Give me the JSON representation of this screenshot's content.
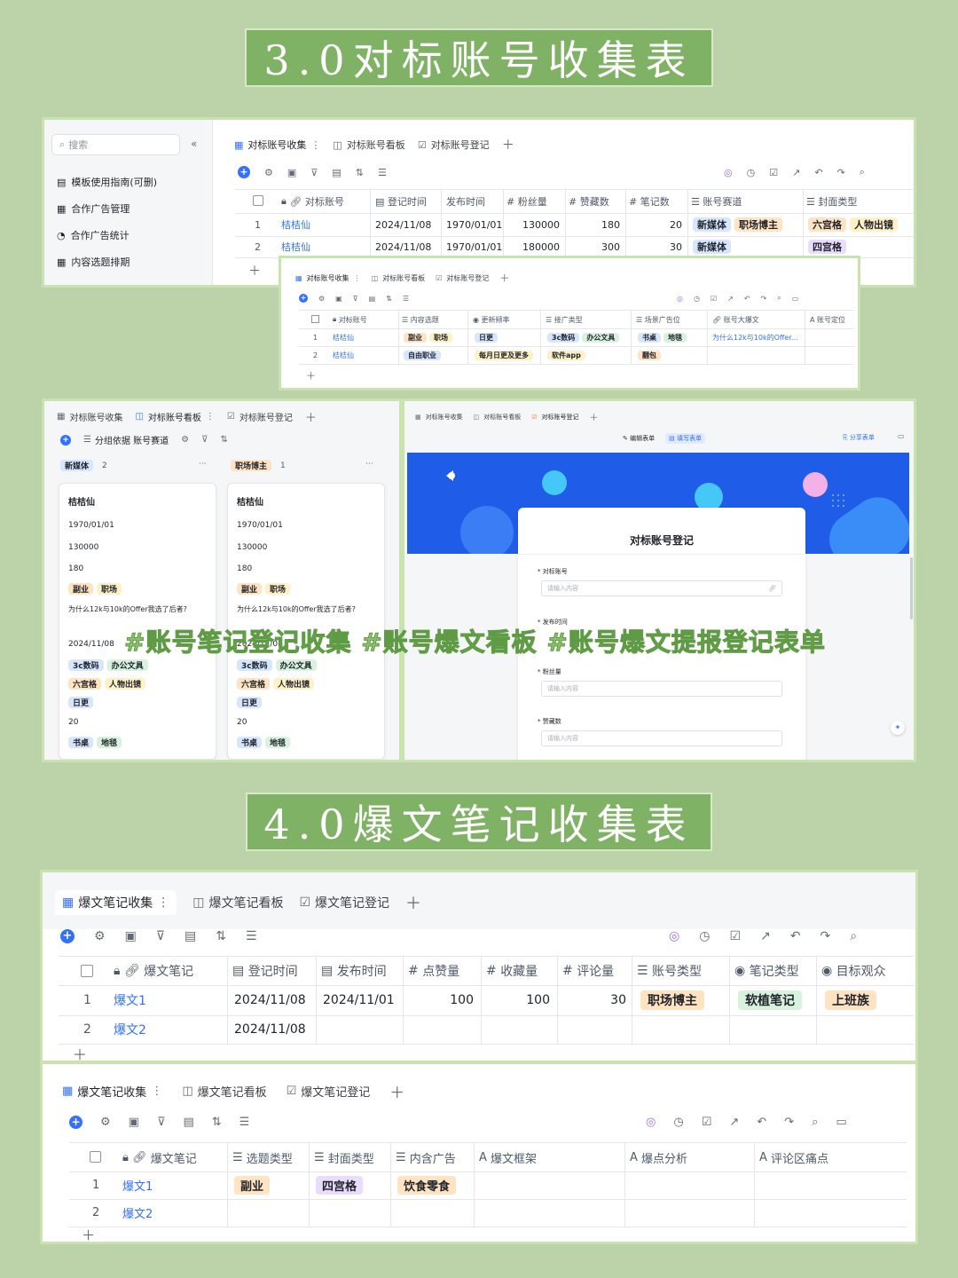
{
  "banners": {
    "top": "3.0对标账号收集表",
    "bottom": "4.0爆文笔记收集表"
  },
  "hashtags": "#账号笔记登记收集 #账号爆文看板 #账号爆文提报登记表单",
  "colors": {
    "background": "#bcd2a8",
    "banner": "#7fb265",
    "accent": "#3370ff"
  },
  "s1": {
    "search_placeholder": "搜索",
    "sidebar": [
      "模板使用指南(可删)",
      "合作广告管理",
      "合作广告统计",
      "内容选题排期"
    ],
    "tabs": [
      "对标账号收集",
      "对标账号看板",
      "对标账号登记"
    ],
    "headers": [
      "对标账号",
      "登记时间",
      "发布时间",
      "粉丝量",
      "赞藏数",
      "笔记数",
      "账号赛道",
      "封面类型"
    ],
    "rows": [
      {
        "no": "1",
        "name": "桔桔仙",
        "reg": "2024/11/08",
        "pub": "1970/01/01",
        "fans": "130000",
        "likes": "180",
        "notes": "20",
        "track": [
          "新媒体",
          "职场博主"
        ],
        "cover": [
          "六宫格",
          "人物出镜"
        ]
      },
      {
        "no": "2",
        "name": "桔桔仙",
        "reg": "2024/11/08",
        "pub": "1970/01/01",
        "fans": "180000",
        "likes": "300",
        "notes": "30",
        "track": [
          "新媒体"
        ],
        "cover": [
          "四宫格"
        ]
      }
    ]
  },
  "s2": {
    "tabs": [
      "对标账号收集",
      "对标账号看板",
      "对标账号登记"
    ],
    "headers": [
      "对标账号",
      "内容选题",
      "更新频率",
      "接广类型",
      "场景广告位",
      "账号大爆文",
      "账号定位"
    ],
    "rows": [
      {
        "no": "1",
        "name": "桔桔仙",
        "topic": [
          "副业",
          "职场"
        ],
        "freq": [
          "日更"
        ],
        "ad": [
          "3c数码",
          "办公文具"
        ],
        "scene": [
          "书桌",
          "地毯"
        ],
        "hit": "为什么12k与10k的Offer..."
      },
      {
        "no": "2",
        "name": "桔桔仙",
        "topic": [
          "自由职业"
        ],
        "freq": [
          "每月日更及更多"
        ],
        "ad": [
          "软件app"
        ],
        "scene": [
          "翻包"
        ],
        "hit": ""
      }
    ]
  },
  "s3": {
    "tabs": [
      "对标账号收集",
      "对标账号看板",
      "对标账号登记"
    ],
    "group_label": "分组依据 账号赛道",
    "columns": [
      {
        "name": "新媒体",
        "count": "2"
      },
      {
        "name": "职场博主",
        "count": "1"
      }
    ],
    "card": {
      "title": "桔桔仙",
      "pub": "1970/01/01",
      "fans": "130000",
      "likes": "180",
      "topic": [
        "副业",
        "职场"
      ],
      "hit": "为什么12k与10k的Offer我选了后者?",
      "reg": "2024/11/08",
      "ad": [
        "3c数码",
        "办公文具"
      ],
      "cover": [
        "六宫格",
        "人物出镜"
      ],
      "freq": [
        "日更"
      ],
      "notes": "20",
      "scene": [
        "书桌",
        "地毯"
      ]
    }
  },
  "s4": {
    "tabs": [
      "对标账号收集",
      "对标账号看板",
      "对标账号登记"
    ],
    "edit_form": "编辑表单",
    "fill_form": "填写表单",
    "share_form": "分享表单",
    "form_title": "对标账号登记",
    "fields": [
      {
        "label": "* 对标账号",
        "placeholder": "请输入内容"
      },
      {
        "label": "* 发布时间",
        "placeholder": ""
      },
      {
        "label": "* 粉丝量",
        "placeholder": "请输入内容"
      },
      {
        "label": "* 赞藏数",
        "placeholder": "请输入内容"
      }
    ]
  },
  "s5": {
    "tabs": [
      "爆文笔记收集",
      "爆文笔记看板",
      "爆文笔记登记"
    ],
    "headers": [
      "爆文笔记",
      "登记时间",
      "发布时间",
      "点赞量",
      "收藏量",
      "评论量",
      "账号类型",
      "笔记类型",
      "目标观众"
    ],
    "rows": [
      {
        "no": "1",
        "name": "爆文1",
        "reg": "2024/11/08",
        "pub": "2024/11/01",
        "like": "100",
        "fav": "100",
        "cmt": "30",
        "acct": "职场博主",
        "type": "软植笔记",
        "aud": "上班族"
      },
      {
        "no": "2",
        "name": "爆文2",
        "reg": "2024/11/08",
        "pub": "",
        "like": "",
        "fav": "",
        "cmt": "",
        "acct": "",
        "type": "",
        "aud": ""
      }
    ]
  },
  "s6": {
    "tabs": [
      "爆文笔记收集",
      "爆文笔记看板",
      "爆文笔记登记"
    ],
    "headers": [
      "爆文笔记",
      "选题类型",
      "封面类型",
      "内含广告",
      "爆文框架",
      "爆点分析",
      "评论区痛点"
    ],
    "rows": [
      {
        "no": "1",
        "name": "爆文1",
        "topic": "副业",
        "cover": "四宫格",
        "ad": "饮食零食"
      },
      {
        "no": "2",
        "name": "爆文2",
        "topic": "",
        "cover": "",
        "ad": ""
      }
    ]
  }
}
